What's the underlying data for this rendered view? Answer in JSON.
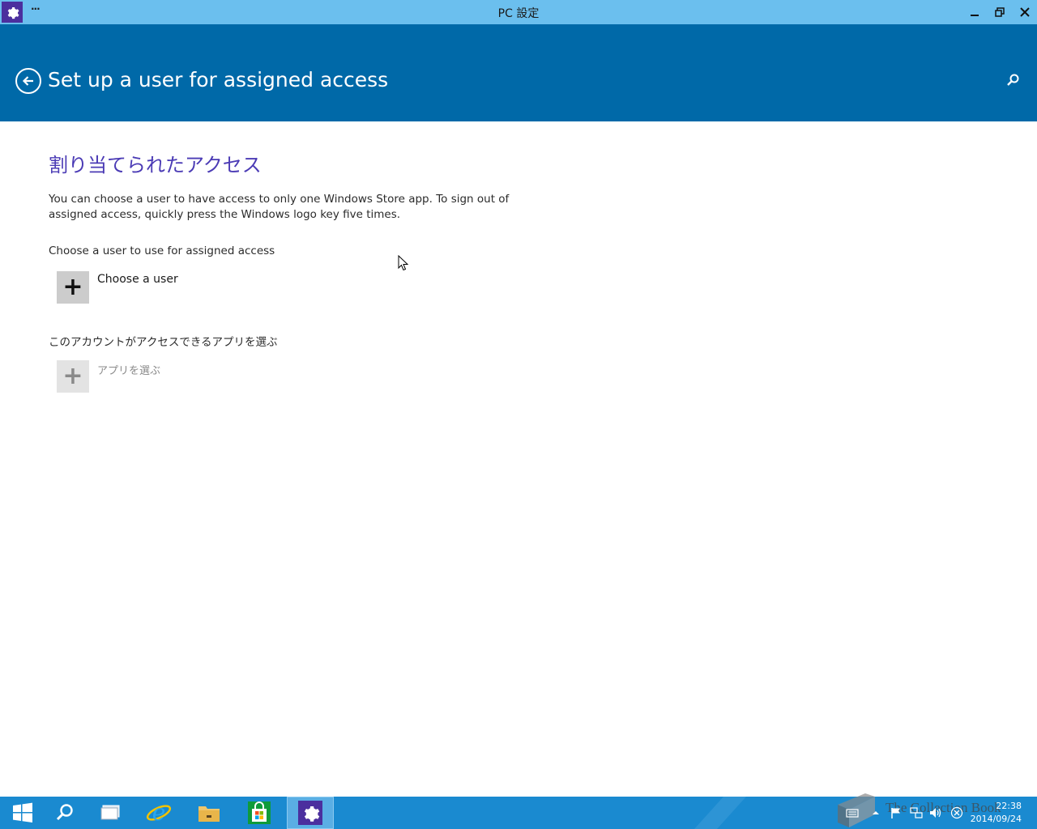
{
  "window": {
    "title": "PC 設定",
    "menu_glyph": "···"
  },
  "header": {
    "page_title": "Set up a user for assigned access"
  },
  "main": {
    "section_heading": "割り当てられたアクセス",
    "description": "You can choose a user to have access to only one Windows Store app. To sign out of assigned access, quickly press the Windows logo key five times.",
    "user_label": "Choose a user to use for assigned access",
    "choose_user_label": "Choose a user",
    "app_label": "このアカウントがアクセスできるアプリを選ぶ",
    "choose_app_label": "アプリを選ぶ",
    "plus_glyph": "+"
  },
  "taskbar": {
    "items": [
      "start-icon",
      "search-icon",
      "task-view-icon",
      "internet-explorer-icon",
      "file-explorer-icon",
      "store-icon",
      "settings-icon"
    ],
    "active_item": "settings-icon",
    "clock_time": "22:38",
    "clock_date": "2014/09/24",
    "watermark": "The Collection Book"
  },
  "colors": {
    "titlebar": "#6bbfee",
    "header": "#0069a8",
    "heading_accent": "#4b3bb5",
    "taskbar": "#1a8ad0",
    "app_icon_bg": "#4b2f9e"
  }
}
